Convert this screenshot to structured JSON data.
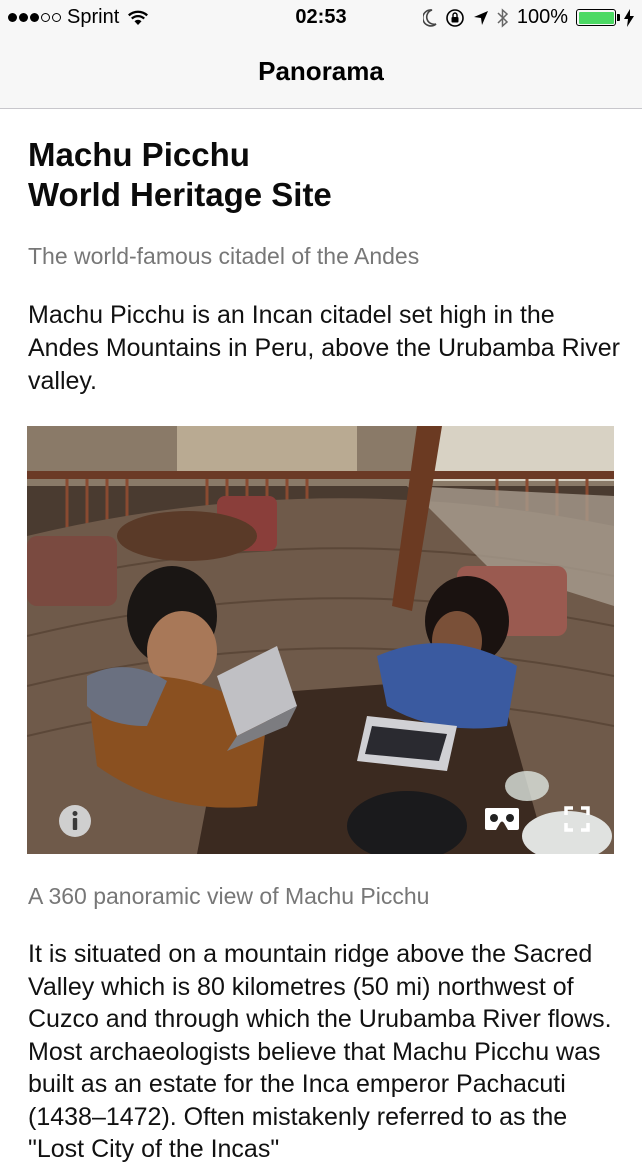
{
  "status_bar": {
    "carrier": "Sprint",
    "time": "02:53",
    "battery": "100%",
    "signal_icon": "signal-dots-icon",
    "wifi_icon": "wifi-icon",
    "moon_icon": "moon-icon",
    "lock_icon": "rotation-lock-icon",
    "location_icon": "location-arrow-icon",
    "bluetooth_icon": "bluetooth-icon",
    "charging_icon": "charging-bolt-icon",
    "battery_color": "#4cd964"
  },
  "nav": {
    "title": "Panorama"
  },
  "article": {
    "title_line1": "Machu Picchu",
    "title_line2": "World Heritage Site",
    "subtitle": "The world-famous citadel of the Andes",
    "intro": "Machu Picchu is an Incan citadel set high in the Andes Mountains in Peru, above the Urubamba River valley.",
    "panorama_caption": "A 360 panoramic view of Machu Picchu",
    "body": "It is situated on a mountain ridge above the Sacred Valley which is 80 kilometres (50 mi) northwest of Cuzco and through which the Urubamba River flows. Most archaeologists believe that Machu Picchu was built as an estate for the Inca emperor Pachacuti (1438–1472). Often mistakenly referred to as the \"Lost City of the Incas\"",
    "panorama_controls": {
      "info_icon": "info-icon",
      "cardboard_icon": "vr-cardboard-icon",
      "fullscreen_icon": "fullscreen-icon"
    }
  }
}
